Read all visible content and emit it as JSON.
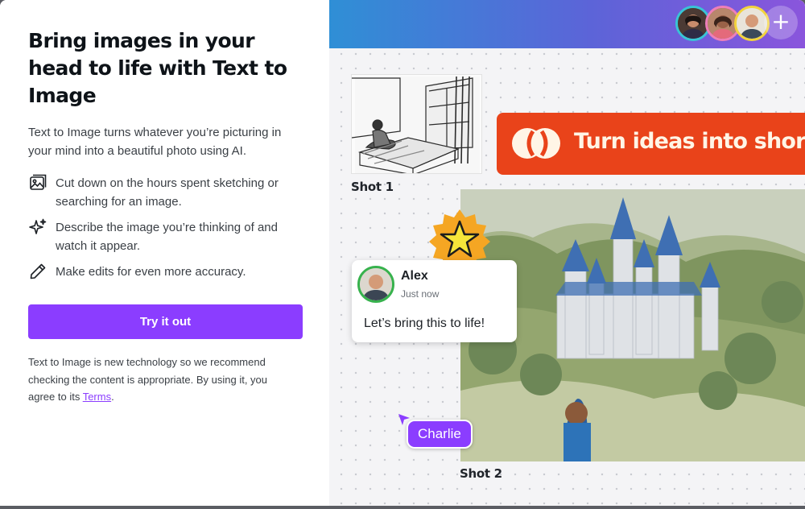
{
  "left": {
    "title": "Bring images in your head to life with Text to Image",
    "description": "Text to Image turns whatever you’re picturing in your mind into a beautiful photo using AI.",
    "features": [
      {
        "icon": "image-icon",
        "text": "Cut down on the hours spent sketching or searching for an image."
      },
      {
        "icon": "sparkle-icon",
        "text": "Describe the image you’re thinking of and watch it appear."
      },
      {
        "icon": "pencil-icon",
        "text": "Make edits for even more accuracy."
      }
    ],
    "cta_label": "Try it out",
    "disclaimer_prefix": "Text to Image is new technology so we recommend checking the content is appropriate. By using it, you agree to its ",
    "terms_label": "Terms",
    "disclaimer_suffix": "."
  },
  "right": {
    "collaborators_add": "+",
    "shot1_label": "Shot 1",
    "shot2_label": "Shot 2",
    "banner_text": "Turn ideas into short videos",
    "comment": {
      "name": "Alex",
      "time": "Just now",
      "message": "Let’s bring this to life!"
    },
    "cursor_label": "Charlie"
  },
  "colors": {
    "accent": "#8b3dff",
    "banner": "#e9431a",
    "title_text": "#0e1318",
    "body_text": "#3a3f45"
  }
}
